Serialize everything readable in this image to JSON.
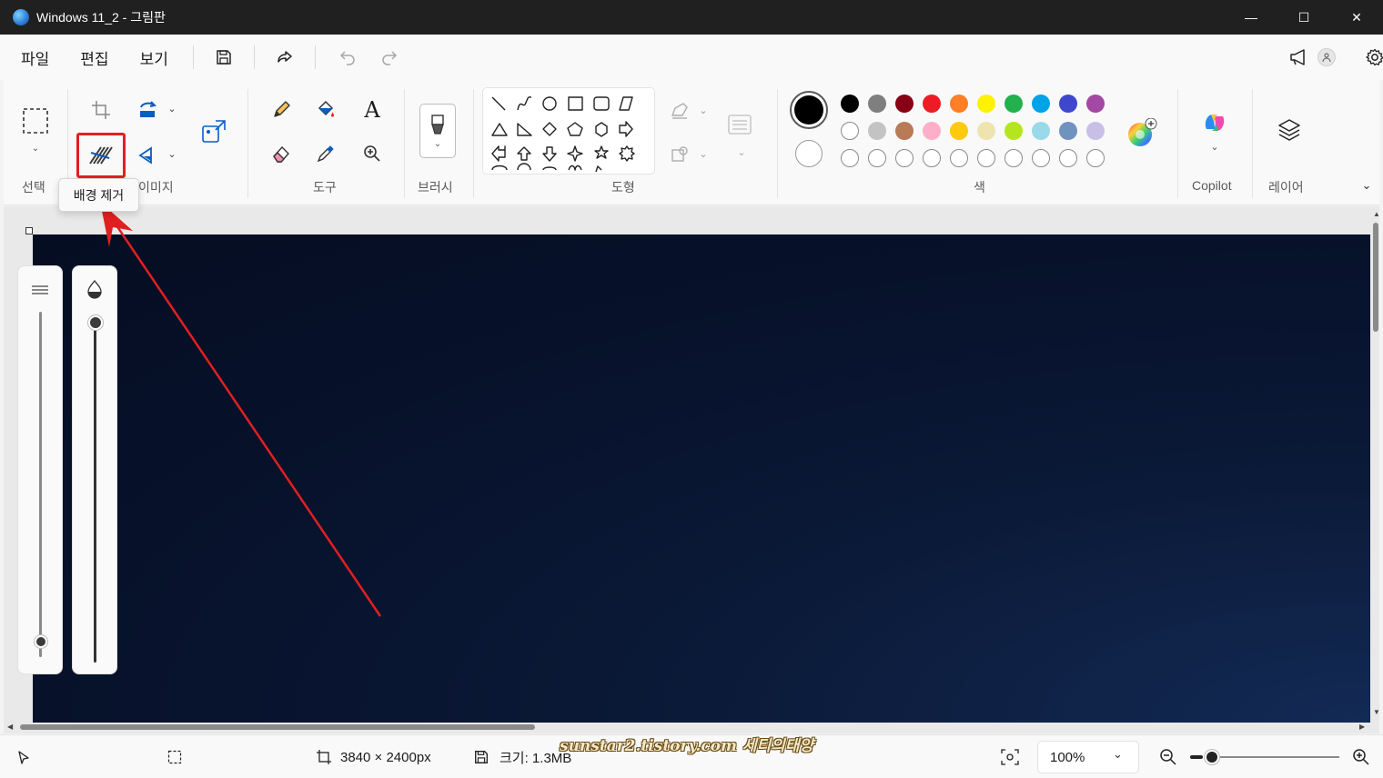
{
  "window": {
    "title": "Windows 11_2 - 그림판",
    "minimize_glyph": "—",
    "maximize_glyph": "☐",
    "close_glyph": "✕"
  },
  "menu": {
    "items": [
      "파일",
      "편집",
      "보기"
    ]
  },
  "ribbon": {
    "groups": {
      "select": "선택",
      "image": "이미지",
      "tools": "도구",
      "brushes": "브러시",
      "shapes": "도형",
      "colors": "색",
      "copilot": "Copilot",
      "layers": "레이어"
    },
    "tooltip": "배경 제거",
    "colors_row1": [
      "#000000",
      "#7f7f7f",
      "#880015",
      "#ed1c24",
      "#ff7f27",
      "#fff200",
      "#22b14c",
      "#00a2e8",
      "#3f48cc",
      "#a349a4"
    ],
    "colors_row2": [
      "#ffffff",
      "#c3c3c3",
      "#b97a57",
      "#ffaec9",
      "#ffc90e",
      "#efe4b0",
      "#b5e61d",
      "#99d9ea",
      "#7092be",
      "#c8bfe7"
    ],
    "primary_color": "#000000",
    "secondary_color": "#ffffff",
    "highlight_color": "#e02020"
  },
  "status": {
    "dimensions": "3840 × 2400px",
    "size": "크기: 1.3MB",
    "zoom": "100%",
    "zoom_level": 0.05
  },
  "watermark": "sunstar2.tistory.com 세티의태양",
  "annotation": {
    "arrow_color": "#e02020"
  }
}
